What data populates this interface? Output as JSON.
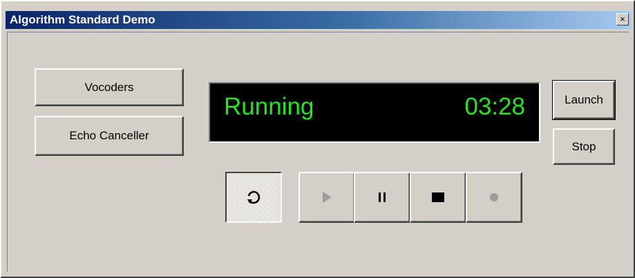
{
  "window": {
    "title": "Algorithm Standard Demo",
    "close_glyph": "×"
  },
  "buttons": {
    "vocoders": "Vocoders",
    "echo_canceller": "Echo Canceller",
    "launch": "Launch",
    "stop": "Stop"
  },
  "display": {
    "status": "Running",
    "time": "03:28",
    "color": "#21e521"
  },
  "transport": {
    "loop_icon": "loop-icon",
    "play_icon": "play-icon",
    "pause_icon": "pause-icon",
    "stop_icon": "stop-icon",
    "record_icon": "record-icon",
    "play_enabled": false,
    "pause_enabled": true,
    "stop_enabled": true,
    "record_enabled": false,
    "loop_pressed": true
  },
  "colors": {
    "face": "#d4d0c8",
    "title_start": "#0a246a",
    "title_end": "#a6caf0",
    "disabled_icon": "#9b9b9b"
  }
}
